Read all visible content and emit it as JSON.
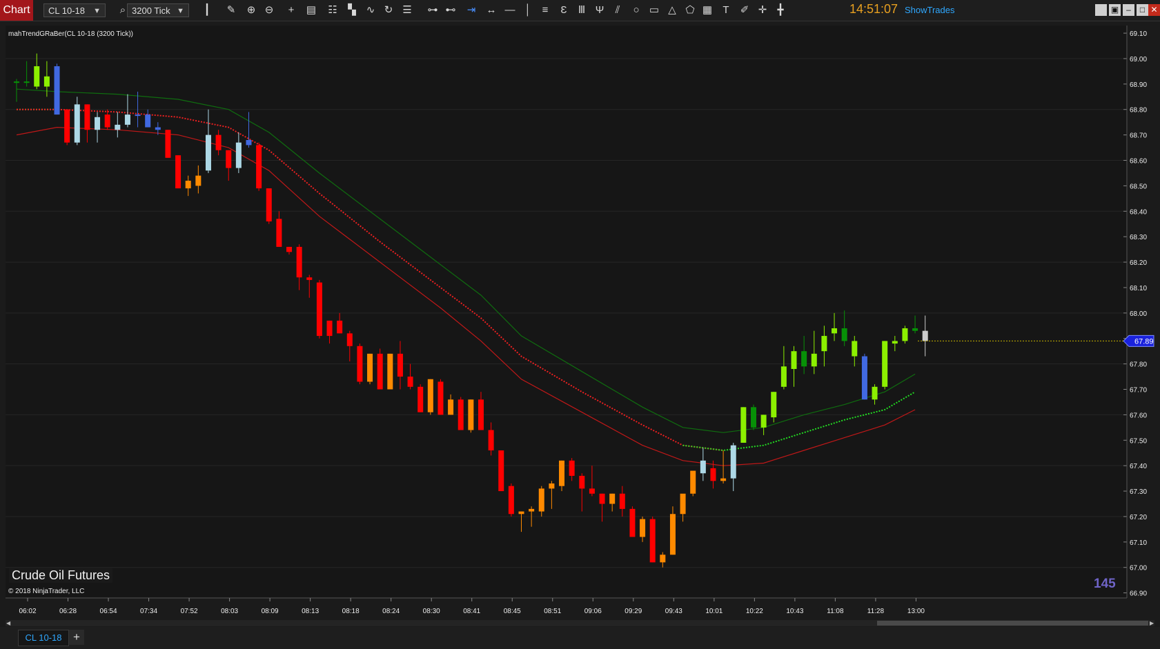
{
  "toolbar": {
    "app_label": "Chart",
    "instrument": "CL 10-18",
    "interval": "3200 Tick",
    "clock": "14:51:07",
    "show_trades": "ShowTrades",
    "icons": [
      "bar-type-icon",
      "pencil-icon",
      "zoom-in-icon",
      "zoom-out-icon",
      "crosshair-icon",
      "data-box-icon",
      "properties-icon",
      "indicators-icon",
      "strategies-icon",
      "refresh-icon",
      "list-icon",
      "ruler-icon",
      "risk-reward-icon",
      "arrow-line-icon",
      "extended-line-icon",
      "horizontal-line-icon",
      "vertical-line-icon",
      "fib-retracement-icon",
      "fib-extension-icon",
      "fib-time-icon",
      "andrews-pitchfork-icon",
      "gann-fan-icon",
      "ellipse-icon",
      "rectangle-icon",
      "triangle-icon",
      "polygon-icon",
      "region-icon",
      "text-icon",
      "marker-icon",
      "plus-icon",
      "cross-icon"
    ],
    "window_buttons": [
      "tile-icon",
      "restore-icon",
      "minimize-icon",
      "maximize-icon",
      "close-icon"
    ]
  },
  "chart": {
    "indicator_label": "mahTrendGRaBer(CL 10-18 (3200 Tick))",
    "instrument_name": "Crude Oil Futures",
    "copyright": "© 2018 NinjaTrader, LLC",
    "bar_counter": "145",
    "last_price_label": "67.89",
    "colors": {
      "background": "#161616",
      "grid": "#262626",
      "up_strong": "#8cf000",
      "up": "#079107",
      "down": "#ff0000",
      "down_weak": "#ff8a00",
      "neutral_up": "#add8e6",
      "neutral_down": "#4169e1",
      "upper_band": "#0f6d0f",
      "lower_band": "#c01818",
      "mid_up": "#22dd22",
      "mid_down": "#ee2020",
      "price_line": "#c8b400",
      "price_tag": "#1a22dd"
    }
  },
  "chart_data": {
    "type": "candlestick",
    "ylim": [
      66.88,
      69.13
    ],
    "y_ticks": [
      69.1,
      69.0,
      68.9,
      68.8,
      68.7,
      68.6,
      68.5,
      68.4,
      68.3,
      68.2,
      68.1,
      68.0,
      67.9,
      67.8,
      67.7,
      67.6,
      67.5,
      67.4,
      67.3,
      67.2,
      67.1,
      67.0,
      66.9
    ],
    "x_ticks": [
      {
        "label": "06:02",
        "bar": 0
      },
      {
        "label": "06:28",
        "bar": 4
      },
      {
        "label": "06:54",
        "bar": 8
      },
      {
        "label": "07:34",
        "bar": 12
      },
      {
        "label": "07:52",
        "bar": 16
      },
      {
        "label": "08:03",
        "bar": 20
      },
      {
        "label": "08:09",
        "bar": 24
      },
      {
        "label": "08:13",
        "bar": 28
      },
      {
        "label": "08:18",
        "bar": 32
      },
      {
        "label": "08:24",
        "bar": 36
      },
      {
        "label": "08:30",
        "bar": 40
      },
      {
        "label": "08:41",
        "bar": 44
      },
      {
        "label": "08:45",
        "bar": 48
      },
      {
        "label": "08:51",
        "bar": 52
      },
      {
        "label": "09:06",
        "bar": 56
      },
      {
        "label": "09:29",
        "bar": 60
      },
      {
        "label": "09:43",
        "bar": 64
      },
      {
        "label": "10:01",
        "bar": 68
      },
      {
        "label": "10:22",
        "bar": 72
      },
      {
        "label": "10:43",
        "bar": 76
      },
      {
        "label": "11:08",
        "bar": 80
      },
      {
        "label": "11:28",
        "bar": 84
      },
      {
        "label": "13:00",
        "bar": 88
      }
    ],
    "bars": [
      {
        "o": 68.91,
        "h": 68.92,
        "l": 68.83,
        "c": 68.91,
        "k": "up"
      },
      {
        "o": 68.91,
        "h": 68.99,
        "l": 68.89,
        "c": 68.91,
        "k": "up"
      },
      {
        "o": 68.89,
        "h": 69.02,
        "l": 68.88,
        "c": 68.97,
        "k": "upS"
      },
      {
        "o": 68.89,
        "h": 68.99,
        "l": 68.85,
        "c": 68.93,
        "k": "upS"
      },
      {
        "o": 68.97,
        "h": 68.98,
        "l": 68.78,
        "c": 68.78,
        "k": "ndn"
      },
      {
        "o": 68.8,
        "h": 68.8,
        "l": 68.66,
        "c": 68.67,
        "k": "dn"
      },
      {
        "o": 68.67,
        "h": 68.85,
        "l": 68.66,
        "c": 68.82,
        "k": "nup"
      },
      {
        "o": 68.82,
        "h": 68.82,
        "l": 68.67,
        "c": 68.72,
        "k": "dn"
      },
      {
        "o": 68.72,
        "h": 68.79,
        "l": 68.67,
        "c": 68.77,
        "k": "nup"
      },
      {
        "o": 68.78,
        "h": 68.8,
        "l": 68.72,
        "c": 68.73,
        "k": "dn"
      },
      {
        "o": 68.72,
        "h": 68.79,
        "l": 68.69,
        "c": 68.74,
        "k": "nup"
      },
      {
        "o": 68.74,
        "h": 68.86,
        "l": 68.73,
        "c": 68.78,
        "k": "nup"
      },
      {
        "o": 68.78,
        "h": 68.87,
        "l": 68.73,
        "c": 68.78,
        "k": "ndn"
      },
      {
        "o": 68.78,
        "h": 68.8,
        "l": 68.73,
        "c": 68.73,
        "k": "ndn"
      },
      {
        "o": 68.73,
        "h": 68.75,
        "l": 68.7,
        "c": 68.72,
        "k": "ndn"
      },
      {
        "o": 68.72,
        "h": 68.72,
        "l": 68.61,
        "c": 68.61,
        "k": "dn"
      },
      {
        "o": 68.62,
        "h": 68.62,
        "l": 68.49,
        "c": 68.49,
        "k": "dn"
      },
      {
        "o": 68.49,
        "h": 68.54,
        "l": 68.46,
        "c": 68.52,
        "k": "dnW"
      },
      {
        "o": 68.5,
        "h": 68.58,
        "l": 68.47,
        "c": 68.54,
        "k": "dnW"
      },
      {
        "o": 68.56,
        "h": 68.8,
        "l": 68.55,
        "c": 68.7,
        "k": "nup"
      },
      {
        "o": 68.7,
        "h": 68.72,
        "l": 68.62,
        "c": 68.64,
        "k": "dn"
      },
      {
        "o": 68.64,
        "h": 68.64,
        "l": 68.52,
        "c": 68.57,
        "k": "dn"
      },
      {
        "o": 68.57,
        "h": 68.71,
        "l": 68.55,
        "c": 68.67,
        "k": "nup"
      },
      {
        "o": 68.66,
        "h": 68.79,
        "l": 68.65,
        "c": 68.68,
        "k": "ndn"
      },
      {
        "o": 68.66,
        "h": 68.67,
        "l": 68.48,
        "c": 68.49,
        "k": "dn"
      },
      {
        "o": 68.49,
        "h": 68.49,
        "l": 68.35,
        "c": 68.36,
        "k": "dn"
      },
      {
        "o": 68.37,
        "h": 68.4,
        "l": 68.26,
        "c": 68.26,
        "k": "dn"
      },
      {
        "o": 68.26,
        "h": 68.26,
        "l": 68.23,
        "c": 68.24,
        "k": "dn"
      },
      {
        "o": 68.26,
        "h": 68.27,
        "l": 68.09,
        "c": 68.14,
        "k": "dn"
      },
      {
        "o": 68.14,
        "h": 68.15,
        "l": 68.06,
        "c": 68.13,
        "k": "dn"
      },
      {
        "o": 68.12,
        "h": 68.13,
        "l": 67.9,
        "c": 67.91,
        "k": "dn"
      },
      {
        "o": 67.91,
        "h": 67.97,
        "l": 67.88,
        "c": 67.97,
        "k": "dn"
      },
      {
        "o": 67.97,
        "h": 68.0,
        "l": 67.92,
        "c": 67.92,
        "k": "dn"
      },
      {
        "o": 67.92,
        "h": 67.93,
        "l": 67.81,
        "c": 67.87,
        "k": "dn"
      },
      {
        "o": 67.87,
        "h": 67.88,
        "l": 67.72,
        "c": 67.73,
        "k": "dn"
      },
      {
        "o": 67.73,
        "h": 67.84,
        "l": 67.72,
        "c": 67.84,
        "k": "dnW"
      },
      {
        "o": 67.84,
        "h": 67.86,
        "l": 67.7,
        "c": 67.7,
        "k": "dn"
      },
      {
        "o": 67.7,
        "h": 67.84,
        "l": 67.7,
        "c": 67.84,
        "k": "dnW"
      },
      {
        "o": 67.84,
        "h": 67.89,
        "l": 67.7,
        "c": 67.75,
        "k": "dn"
      },
      {
        "o": 67.75,
        "h": 67.8,
        "l": 67.7,
        "c": 67.71,
        "k": "dn"
      },
      {
        "o": 67.71,
        "h": 67.72,
        "l": 67.61,
        "c": 67.61,
        "k": "dn"
      },
      {
        "o": 67.61,
        "h": 67.74,
        "l": 67.6,
        "c": 67.74,
        "k": "dnW"
      },
      {
        "o": 67.73,
        "h": 67.74,
        "l": 67.6,
        "c": 67.6,
        "k": "dn"
      },
      {
        "o": 67.6,
        "h": 67.68,
        "l": 67.6,
        "c": 67.66,
        "k": "dnW"
      },
      {
        "o": 67.66,
        "h": 67.67,
        "l": 67.54,
        "c": 67.54,
        "k": "dn"
      },
      {
        "o": 67.54,
        "h": 67.66,
        "l": 67.53,
        "c": 67.66,
        "k": "dnW"
      },
      {
        "o": 67.66,
        "h": 67.69,
        "l": 67.54,
        "c": 67.54,
        "k": "dn"
      },
      {
        "o": 67.54,
        "h": 67.57,
        "l": 67.44,
        "c": 67.46,
        "k": "dn"
      },
      {
        "o": 67.46,
        "h": 67.46,
        "l": 67.3,
        "c": 67.3,
        "k": "dn"
      },
      {
        "o": 67.32,
        "h": 67.33,
        "l": 67.2,
        "c": 67.21,
        "k": "dn"
      },
      {
        "o": 67.21,
        "h": 67.22,
        "l": 67.14,
        "c": 67.22,
        "k": "dnW"
      },
      {
        "o": 67.22,
        "h": 67.24,
        "l": 67.16,
        "c": 67.23,
        "k": "dnW"
      },
      {
        "o": 67.22,
        "h": 67.32,
        "l": 67.2,
        "c": 67.31,
        "k": "dnW"
      },
      {
        "o": 67.31,
        "h": 67.34,
        "l": 67.23,
        "c": 67.33,
        "k": "dnW"
      },
      {
        "o": 67.32,
        "h": 67.42,
        "l": 67.3,
        "c": 67.42,
        "k": "dnW"
      },
      {
        "o": 67.42,
        "h": 67.43,
        "l": 67.34,
        "c": 67.36,
        "k": "dn"
      },
      {
        "o": 67.36,
        "h": 67.37,
        "l": 67.22,
        "c": 67.31,
        "k": "dn"
      },
      {
        "o": 67.31,
        "h": 67.4,
        "l": 67.28,
        "c": 67.29,
        "k": "dn"
      },
      {
        "o": 67.29,
        "h": 67.29,
        "l": 67.18,
        "c": 67.25,
        "k": "dn"
      },
      {
        "o": 67.25,
        "h": 67.29,
        "l": 67.22,
        "c": 67.29,
        "k": "dnW"
      },
      {
        "o": 67.29,
        "h": 67.32,
        "l": 67.2,
        "c": 67.23,
        "k": "dn"
      },
      {
        "o": 67.23,
        "h": 67.24,
        "l": 67.12,
        "c": 67.12,
        "k": "dn"
      },
      {
        "o": 67.12,
        "h": 67.2,
        "l": 67.1,
        "c": 67.19,
        "k": "dnW"
      },
      {
        "o": 67.19,
        "h": 67.2,
        "l": 67.02,
        "c": 67.02,
        "k": "dn"
      },
      {
        "o": 67.02,
        "h": 67.06,
        "l": 67.0,
        "c": 67.05,
        "k": "dnW"
      },
      {
        "o": 67.05,
        "h": 67.24,
        "l": 67.05,
        "c": 67.21,
        "k": "dnW"
      },
      {
        "o": 67.21,
        "h": 67.28,
        "l": 67.18,
        "c": 67.29,
        "k": "dnW"
      },
      {
        "o": 67.29,
        "h": 67.38,
        "l": 67.28,
        "c": 67.38,
        "k": "dnW"
      },
      {
        "o": 67.37,
        "h": 67.47,
        "l": 67.34,
        "c": 67.42,
        "k": "nup"
      },
      {
        "o": 67.39,
        "h": 67.42,
        "l": 67.31,
        "c": 67.34,
        "k": "dn"
      },
      {
        "o": 67.34,
        "h": 67.46,
        "l": 67.33,
        "c": 67.35,
        "k": "dnW"
      },
      {
        "o": 67.35,
        "h": 67.49,
        "l": 67.3,
        "c": 67.48,
        "k": "nup"
      },
      {
        "o": 67.49,
        "h": 67.63,
        "l": 67.49,
        "c": 67.63,
        "k": "upS"
      },
      {
        "o": 67.55,
        "h": 67.64,
        "l": 67.54,
        "c": 67.63,
        "k": "up"
      },
      {
        "o": 67.55,
        "h": 67.6,
        "l": 67.52,
        "c": 67.6,
        "k": "upS"
      },
      {
        "o": 67.59,
        "h": 67.69,
        "l": 67.57,
        "c": 67.69,
        "k": "upS"
      },
      {
        "o": 67.71,
        "h": 67.87,
        "l": 67.7,
        "c": 67.79,
        "k": "upS"
      },
      {
        "o": 67.78,
        "h": 67.87,
        "l": 67.71,
        "c": 67.85,
        "k": "upS"
      },
      {
        "o": 67.79,
        "h": 67.91,
        "l": 67.76,
        "c": 67.85,
        "k": "up"
      },
      {
        "o": 67.79,
        "h": 67.93,
        "l": 67.76,
        "c": 67.84,
        "k": "upS"
      },
      {
        "o": 67.85,
        "h": 67.95,
        "l": 67.79,
        "c": 67.91,
        "k": "upS"
      },
      {
        "o": 67.92,
        "h": 68.0,
        "l": 67.89,
        "c": 67.94,
        "k": "upS"
      },
      {
        "o": 67.94,
        "h": 68.01,
        "l": 67.87,
        "c": 67.89,
        "k": "up"
      },
      {
        "o": 67.89,
        "h": 67.91,
        "l": 67.79,
        "c": 67.83,
        "k": "upS"
      },
      {
        "o": 67.83,
        "h": 67.84,
        "l": 67.66,
        "c": 67.66,
        "k": "ndn"
      },
      {
        "o": 67.66,
        "h": 67.72,
        "l": 67.64,
        "c": 67.71,
        "k": "upS"
      },
      {
        "o": 67.71,
        "h": 67.89,
        "l": 67.7,
        "c": 67.89,
        "k": "upS"
      },
      {
        "o": 67.88,
        "h": 67.91,
        "l": 67.85,
        "c": 67.89,
        "k": "upS"
      },
      {
        "o": 67.89,
        "h": 67.95,
        "l": 67.88,
        "c": 67.94,
        "k": "upS"
      },
      {
        "o": 67.93,
        "h": 67.99,
        "l": 67.92,
        "c": 67.94,
        "k": "up"
      },
      {
        "o": 67.89,
        "h": 67.99,
        "l": 67.83,
        "c": 67.93,
        "k": "cur"
      }
    ],
    "bands": [
      {
        "bar": 0,
        "up": 68.88,
        "mid": 68.8,
        "lo": 68.7
      },
      {
        "bar": 4,
        "up": 68.87,
        "mid": 68.8,
        "lo": 68.73
      },
      {
        "bar": 10,
        "up": 68.86,
        "mid": 68.79,
        "lo": 68.72
      },
      {
        "bar": 16,
        "up": 68.84,
        "mid": 68.77,
        "lo": 68.7
      },
      {
        "bar": 21,
        "up": 68.8,
        "mid": 68.73,
        "lo": 68.65
      },
      {
        "bar": 25,
        "up": 68.71,
        "mid": 68.64,
        "lo": 68.56
      },
      {
        "bar": 30,
        "up": 68.55,
        "mid": 68.47,
        "lo": 68.38
      },
      {
        "bar": 36,
        "up": 68.37,
        "mid": 68.28,
        "lo": 68.2
      },
      {
        "bar": 42,
        "up": 68.19,
        "mid": 68.1,
        "lo": 68.02
      },
      {
        "bar": 46,
        "up": 68.07,
        "mid": 67.98,
        "lo": 67.89
      },
      {
        "bar": 50,
        "up": 67.91,
        "mid": 67.83,
        "lo": 67.74
      },
      {
        "bar": 56,
        "up": 67.77,
        "mid": 67.69,
        "lo": 67.61
      },
      {
        "bar": 62,
        "up": 67.63,
        "mid": 67.56,
        "lo": 67.48
      },
      {
        "bar": 66,
        "up": 67.55,
        "mid": 67.48,
        "lo": 67.42
      },
      {
        "bar": 70,
        "up": 67.53,
        "mid": 67.46,
        "lo": 67.4
      },
      {
        "bar": 74,
        "up": 67.55,
        "mid": 67.48,
        "lo": 67.41
      },
      {
        "bar": 78,
        "up": 67.6,
        "mid": 67.53,
        "lo": 67.46
      },
      {
        "bar": 82,
        "up": 67.64,
        "mid": 67.58,
        "lo": 67.51
      },
      {
        "bar": 86,
        "up": 67.69,
        "mid": 67.62,
        "lo": 67.56
      },
      {
        "bar": 89,
        "up": 67.76,
        "mid": 67.69,
        "lo": 67.62
      }
    ],
    "mid_flip_bar": 68,
    "last_price": 67.89
  },
  "bottom": {
    "tab_label": "CL 10-18",
    "add_tab": "+"
  }
}
